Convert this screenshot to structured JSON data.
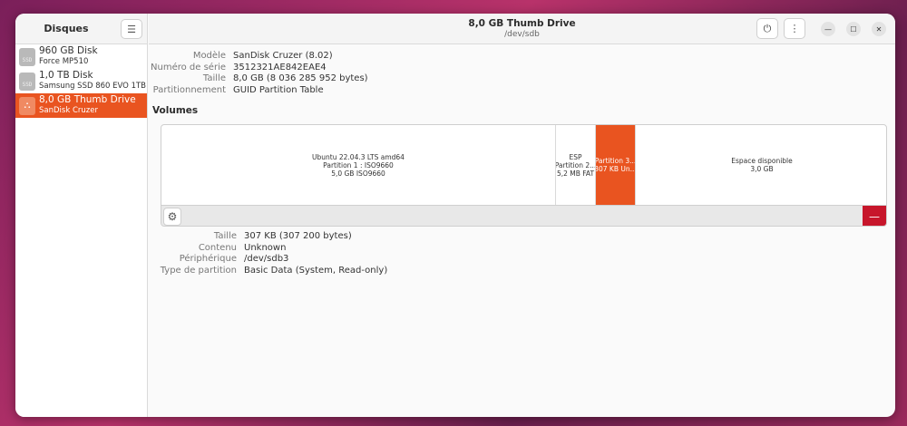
{
  "sidebar": {
    "title": "Disques",
    "menu_icon": "hamburger-icon",
    "disks": [
      {
        "name": "960 GB Disk",
        "sub": "Force MP510",
        "icon": "SSD",
        "selected": false
      },
      {
        "name": "1,0 TB Disk",
        "sub": "Samsung SSD 860 EVO 1TB",
        "icon": "SSD",
        "selected": false
      },
      {
        "name": "8,0 GB Thumb Drive",
        "sub": "SanDisk Cruzer",
        "icon": "usb",
        "selected": true
      }
    ]
  },
  "header": {
    "title": "8,0 GB Thumb Drive",
    "subtitle": "/dev/sdb"
  },
  "drive_info": {
    "rows": [
      {
        "label": "Modèle",
        "value": "SanDisk Cruzer (8.02)"
      },
      {
        "label": "Numéro de série",
        "value": "3512321AE842EAE4"
      },
      {
        "label": "Taille",
        "value": "8,0 GB (8 036 285 952 bytes)"
      },
      {
        "label": "Partitionnement",
        "value": "GUID Partition Table"
      }
    ]
  },
  "volumes": {
    "heading": "Volumes",
    "partitions": [
      {
        "lines": [
          "Ubuntu 22.04.3 LTS amd64",
          "Partition 1 : ISO9660",
          "5,0 GB ISO9660"
        ]
      },
      {
        "lines": [
          "ESP",
          "Partition 2...",
          "5,2 MB FAT"
        ]
      },
      {
        "lines": [
          "Partition 3...",
          "307 KB Un..."
        ]
      },
      {
        "lines": [
          "Espace disponible",
          "3,0 GB"
        ]
      }
    ]
  },
  "partition_detail": {
    "rows": [
      {
        "label": "Taille",
        "value": "307 KB (307 200 bytes)"
      },
      {
        "label": "Contenu",
        "value": "Unknown"
      },
      {
        "label": "Périphérique",
        "value": "/dev/sdb3"
      },
      {
        "label": "Type de partition",
        "value": "Basic Data (System, Read-only)"
      }
    ]
  },
  "colors": {
    "accent": "#e95420",
    "destructive": "#c7162b"
  }
}
